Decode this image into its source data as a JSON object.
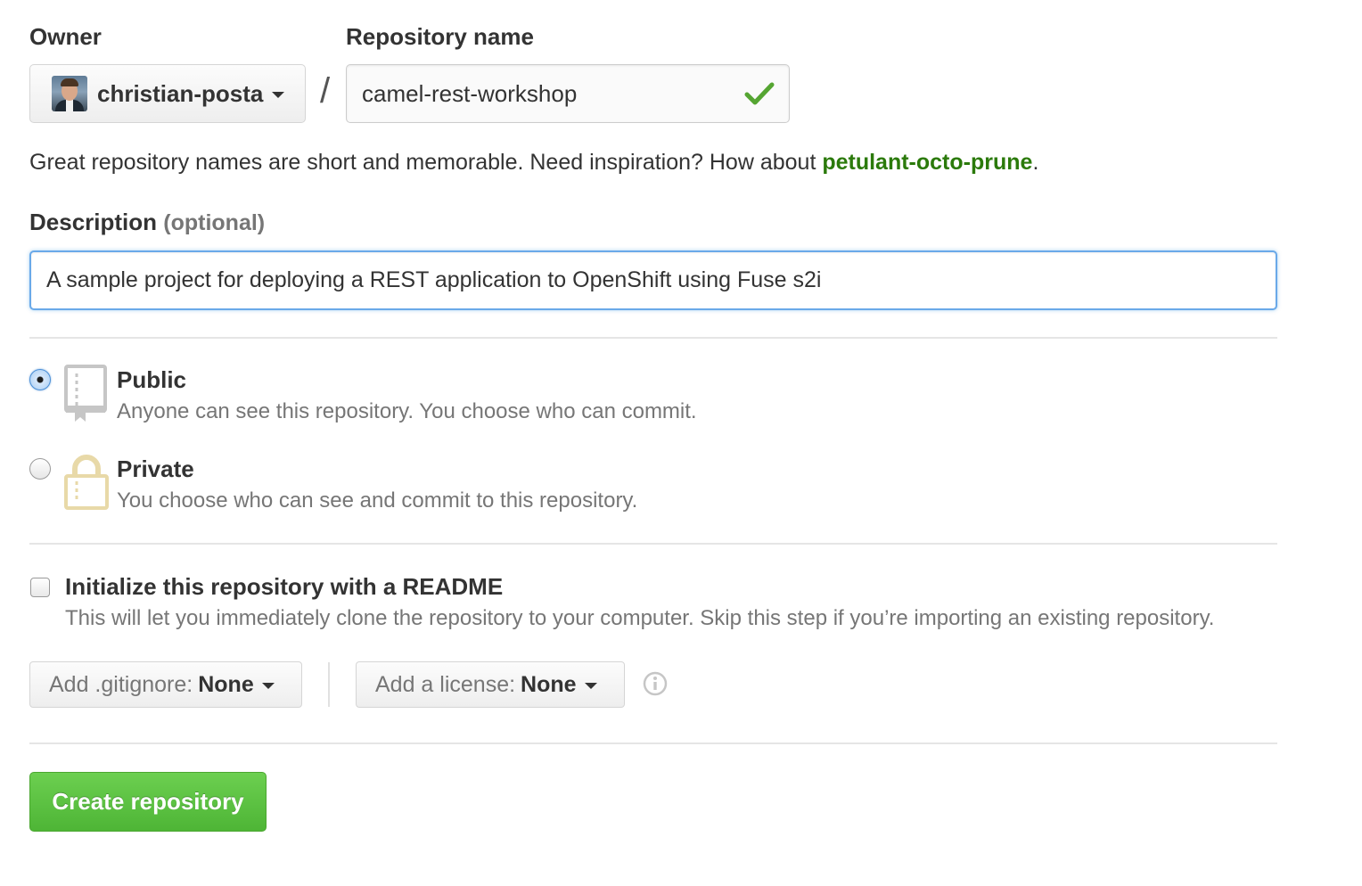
{
  "owner": {
    "label": "Owner",
    "value": "christian-posta",
    "avatar_icon": "user-avatar"
  },
  "repo": {
    "label": "Repository name",
    "separator": "/",
    "value": "camel-rest-workshop",
    "valid_icon": "check-icon",
    "valid_color": "#55a532"
  },
  "hint": {
    "text": "Great repository names are short and memorable. Need inspiration? How about ",
    "suggestion": "petulant-octo-prune",
    "suffix": "."
  },
  "description": {
    "label": "Description",
    "optional": "(optional)",
    "value": "A sample project for deploying a REST application to OpenShift using Fuse s2i"
  },
  "visibility": {
    "selected": "public",
    "options": [
      {
        "id": "public",
        "title": "Public",
        "description": "Anyone can see this repository. You choose who can commit.",
        "icon": "repo-book-icon"
      },
      {
        "id": "private",
        "title": "Private",
        "description": "You choose who can see and commit to this repository.",
        "icon": "lock-icon"
      }
    ]
  },
  "readme": {
    "checked": false,
    "title": "Initialize this repository with a README",
    "description": "This will let you immediately clone the repository to your computer. Skip this step if you’re importing an existing repository."
  },
  "gitignore": {
    "label": "Add .gitignore:",
    "value": "None"
  },
  "license": {
    "label": "Add a license:",
    "value": "None",
    "info_icon": "info-icon"
  },
  "submit": {
    "label": "Create repository",
    "color": "#55b93a"
  }
}
